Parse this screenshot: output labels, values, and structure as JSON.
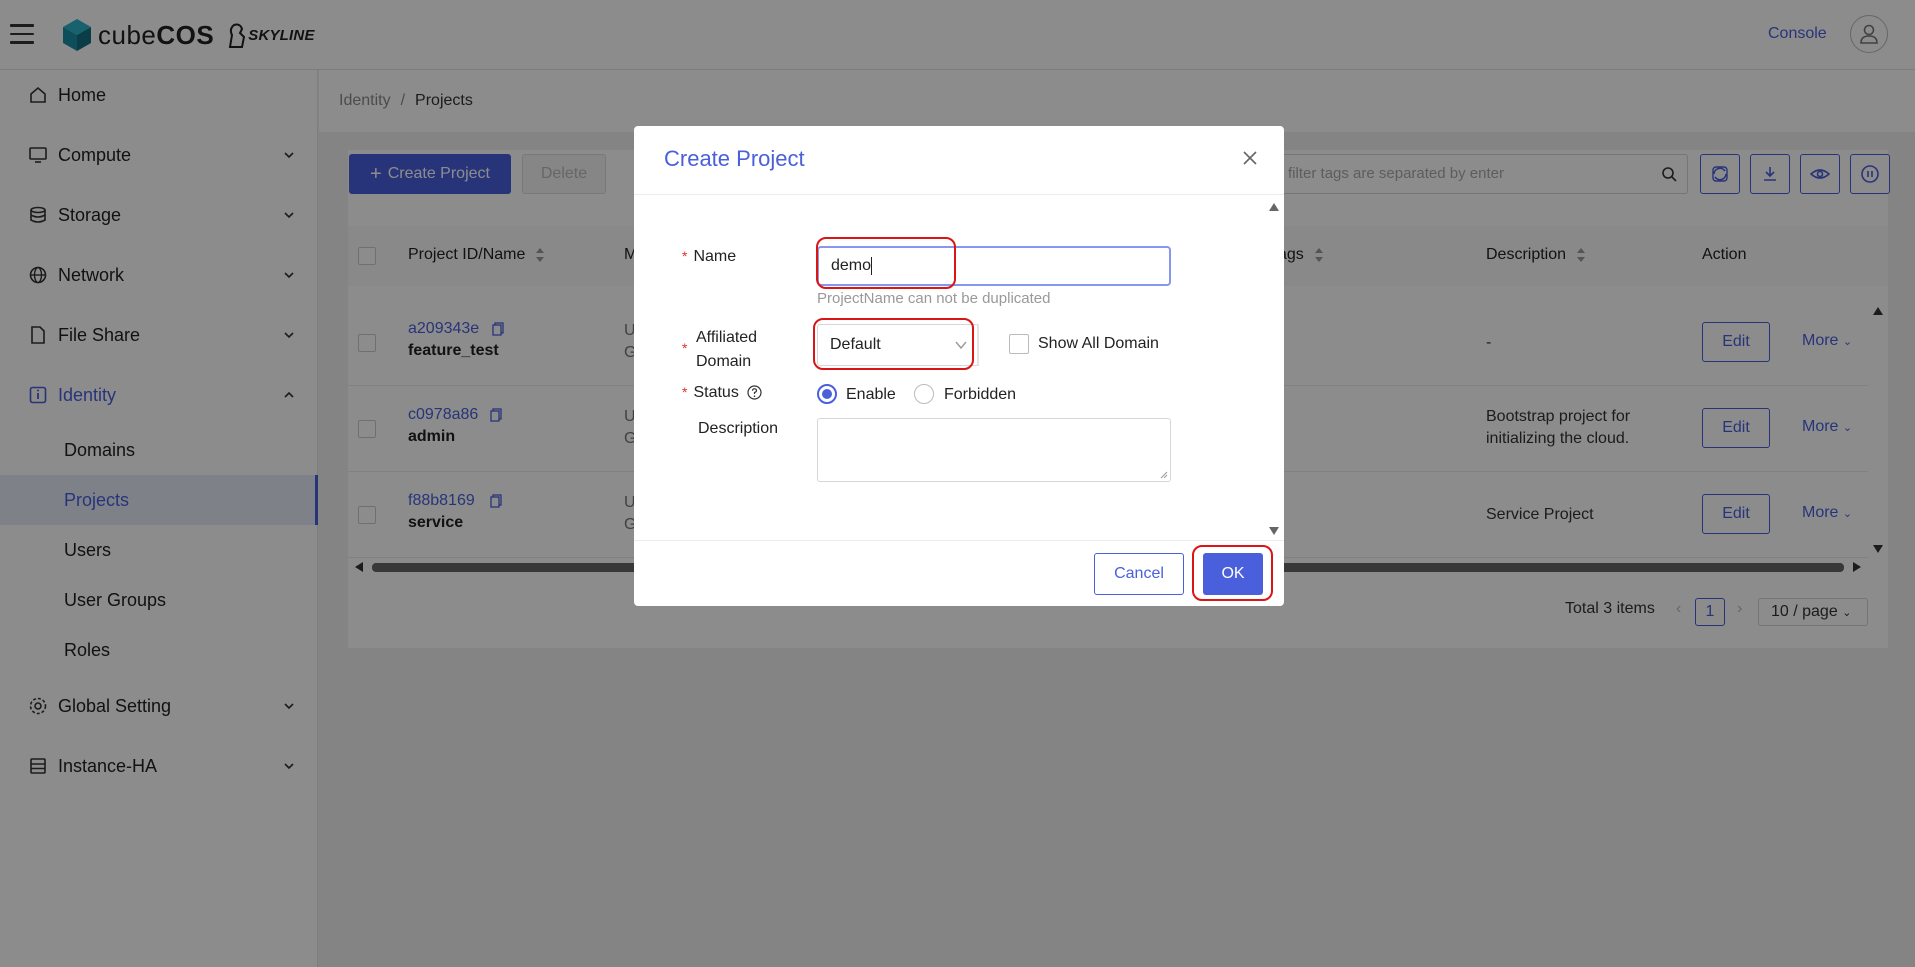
{
  "header": {
    "brand_light": "cube",
    "brand_bold": "COS",
    "partner": "SKYLINE",
    "console_label": "Console"
  },
  "sidebar": {
    "items": [
      {
        "label": "Home",
        "icon": "home-icon"
      },
      {
        "label": "Compute",
        "icon": "monitor-icon"
      },
      {
        "label": "Storage",
        "icon": "database-icon"
      },
      {
        "label": "Network",
        "icon": "globe-icon"
      },
      {
        "label": "File Share",
        "icon": "file-icon"
      },
      {
        "label": "Identity",
        "icon": "info-icon"
      },
      {
        "label": "Global Setting",
        "icon": "gear-icon"
      },
      {
        "label": "Instance-HA",
        "icon": "server-icon"
      }
    ],
    "identity_sub": [
      "Domains",
      "Projects",
      "Users",
      "User Groups",
      "Roles"
    ]
  },
  "breadcrumb": {
    "parent": "Identity",
    "sep": "/",
    "current": "Projects"
  },
  "toolbar": {
    "create_label": "Create Project",
    "delete_label": "Delete",
    "filter_placeholder": "ltiple filter tags are separated by enter"
  },
  "table": {
    "headers": {
      "id_name": "Project ID/Name",
      "m": "M",
      "tags": "ags",
      "description": "Description",
      "action": "Action"
    },
    "rows": [
      {
        "id": "a209343e",
        "name": "feature_test",
        "t1": "U",
        "t2": "G",
        "description": "-"
      },
      {
        "id": "c0978a86",
        "name": "admin",
        "t1": "U",
        "t2": "G",
        "description": "Bootstrap project for initializing the cloud."
      },
      {
        "id": "f88b8169",
        "name": "service",
        "t1": "U",
        "t2": "G",
        "description": "Service Project"
      }
    ],
    "edit_label": "Edit",
    "more_label": "More"
  },
  "pagination": {
    "total": "Total 3 items",
    "page": "1",
    "page_size": "10 / page"
  },
  "modal": {
    "title": "Create Project",
    "name_label": "Name",
    "name_value": "demo",
    "name_hint": "ProjectName can not be duplicated",
    "domain_label_1": "Affiliated",
    "domain_label_2": "Domain",
    "domain_value": "Default",
    "show_all_domain": "Show All Domain",
    "status_label": "Status",
    "status_enable": "Enable",
    "status_forbidden": "Forbidden",
    "description_label": "Description",
    "cancel_label": "Cancel",
    "ok_label": "OK"
  },
  "colors": {
    "accent": "#4a5fdc",
    "required": "#e03030",
    "annotation": "#d91515"
  }
}
